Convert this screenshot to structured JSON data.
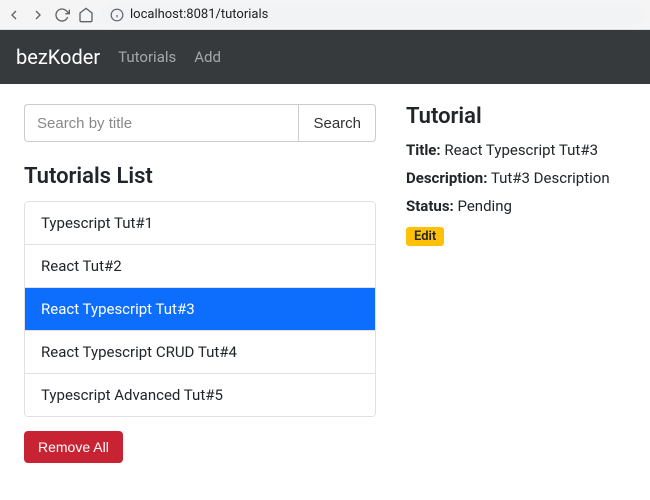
{
  "browser": {
    "url": "localhost:8081/tutorials"
  },
  "navbar": {
    "brand": "bezKoder",
    "links": [
      "Tutorials",
      "Add"
    ]
  },
  "search": {
    "placeholder": "Search by title",
    "button": "Search"
  },
  "list": {
    "heading": "Tutorials List",
    "items": [
      "Typescript Tut#1",
      "React Tut#2",
      "React Typescript Tut#3",
      "React Typescript CRUD Tut#4",
      "Typescript Advanced Tut#5"
    ],
    "selected_index": 2,
    "remove_all": "Remove All"
  },
  "detail": {
    "heading": "Tutorial",
    "title_label": "Title:",
    "title_value": "React Typescript Tut#3",
    "description_label": "Description:",
    "description_value": "Tut#3 Description",
    "status_label": "Status:",
    "status_value": "Pending",
    "edit": "Edit"
  }
}
